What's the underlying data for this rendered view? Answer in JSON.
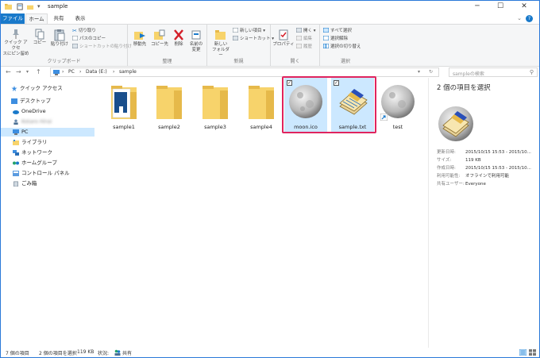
{
  "window": {
    "title": "sample",
    "minimize": "─",
    "maximize": "☐",
    "close": "✕"
  },
  "tabs": [
    "ファイル",
    "ホーム",
    "共有",
    "表示"
  ],
  "help": "?",
  "ribbon": {
    "clipboard": {
      "label": "クリップボード",
      "pin": "クイック アクセス にピン留め",
      "pin_line1": "クイック アクセ",
      "pin_line2": "スにピン留め",
      "copy": "コピー",
      "paste": "貼り付け",
      "cut": "切り取り",
      "copy_path": "パスのコピー",
      "paste_shortcut": "ショートカットの貼り付け"
    },
    "organize": {
      "label": "整理",
      "move_to": "移動先",
      "copy_to": "コピー先",
      "delete": "削除",
      "rename_line1": "名前の",
      "rename_line2": "変更"
    },
    "new": {
      "label": "新規",
      "new_folder_line1": "新しい",
      "new_folder_line2": "フォルダー",
      "new_item": "新しい項目 ▾",
      "shortcut": "ショートカット ▾"
    },
    "open": {
      "label": "開く",
      "properties": "プロパティ",
      "open": "開く ▾",
      "edit": "編集",
      "history": "履歴"
    },
    "select": {
      "label": "選択",
      "select_all": "すべて選択",
      "select_none": "選択解除",
      "invert": "選択の切り替え"
    }
  },
  "nav": {
    "back": "←",
    "forward": "→",
    "recent": "▾",
    "up": "↑",
    "breadcrumb": [
      "PC",
      "Data (E:)",
      "sample"
    ],
    "separator": "›",
    "dropdown": "▾",
    "refresh": "↻",
    "search_placeholder": "sampleの検索",
    "search_icon": "⚲"
  },
  "sidebar": {
    "items": [
      {
        "label": "クイック アクセス",
        "icon": "star-icon"
      },
      {
        "label": "デスクトップ",
        "icon": "desktop-icon"
      },
      {
        "label": "OneDrive",
        "icon": "cloud-icon"
      },
      {
        "label": "Kotaro Hirai",
        "icon": "user-icon"
      },
      {
        "label": "PC",
        "icon": "pc-icon"
      },
      {
        "label": "ライブラリ",
        "icon": "library-icon"
      },
      {
        "label": "ネットワーク",
        "icon": "network-icon"
      },
      {
        "label": "ホームグループ",
        "icon": "homegroup-icon"
      },
      {
        "label": "コントロール パネル",
        "icon": "control-panel-icon"
      },
      {
        "label": "ごみ箱",
        "icon": "recycle-bin-icon"
      }
    ]
  },
  "files": [
    {
      "name": "sample1",
      "type": "folder-with-doc",
      "selected": false
    },
    {
      "name": "sample2",
      "type": "folder",
      "selected": false
    },
    {
      "name": "sample3",
      "type": "folder",
      "selected": false
    },
    {
      "name": "sample4",
      "type": "folder",
      "selected": false
    },
    {
      "name": "moon.ico",
      "type": "moon",
      "selected": true
    },
    {
      "name": "sample.txt",
      "type": "notepad",
      "selected": true
    },
    {
      "name": "test",
      "type": "moon-shortcut",
      "selected": false
    }
  ],
  "details": {
    "title": "2 個の項目を選択",
    "props": [
      {
        "key": "更新日時:",
        "value": "2015/10/15 15:53 - 2015/10..."
      },
      {
        "key": "サイズ:",
        "value": "119 KB"
      },
      {
        "key": "作成日時:",
        "value": "2015/10/15 15:53 - 2015/10..."
      },
      {
        "key": "利用可能性:",
        "value": "オフラインで利用可能"
      },
      {
        "key": "共有ユーザー:",
        "value": "Everyone"
      }
    ]
  },
  "status": {
    "count": "7 個の項目",
    "selection": "2 個の項目を選択",
    "size": "119 KB",
    "state_label": "状況:",
    "state_value": "共有"
  },
  "colors": {
    "accent": "#1979ca",
    "selection": "#cce8ff",
    "highlight_border": "#e0245e",
    "folder": "#f7d36b"
  }
}
